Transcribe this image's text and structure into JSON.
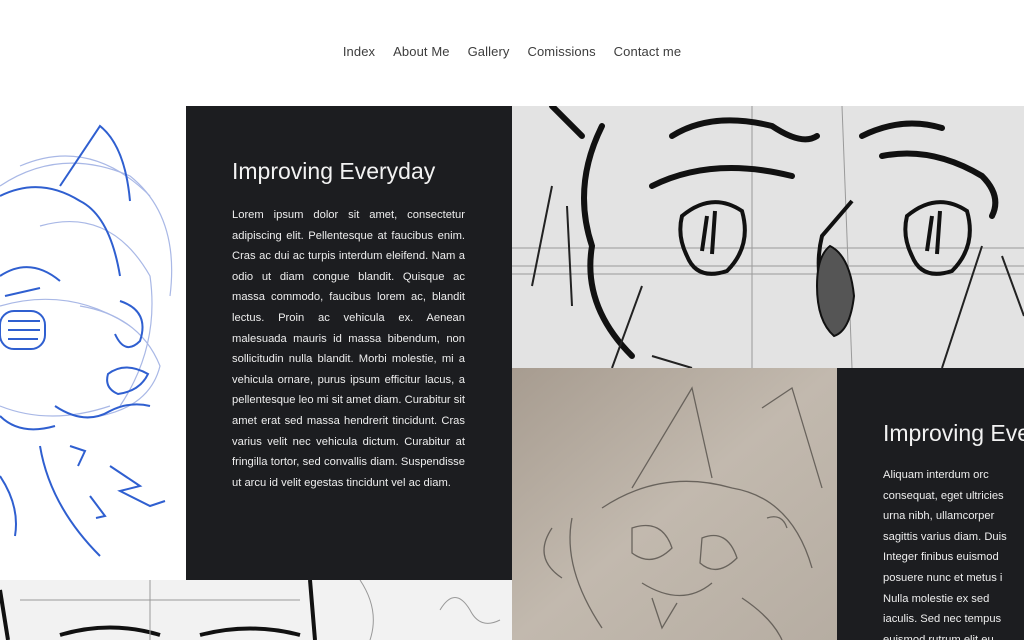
{
  "nav": {
    "items": [
      "Index",
      "About Me",
      "Gallery",
      "Comissions",
      "Contact me"
    ]
  },
  "section1": {
    "title": "Improving Everyday",
    "body": "Lorem ipsum dolor sit amet, consectetur adipiscing elit. Pellentesque at faucibus enim. Cras ac dui ac turpis interdum eleifend. Nam a odio ut diam congue blandit. Quisque ac massa commodo, faucibus lorem ac, blandit lectus. Proin ac vehicula ex. Aenean malesuada mauris id massa bibendum, non sollicitudin nulla blandit. Morbi molestie, mi a vehicula ornare, purus ipsum efficitur lacus, a pellentesque leo mi sit amet diam. Curabitur sit amet erat sed massa hendrerit tincidunt. Cras varius velit nec vehicula dictum. Curabitur at fringilla tortor, sed convallis diam. Suspendisse ut arcu id velit egestas tincidunt vel ac diam."
  },
  "section2": {
    "title": "Improving Eve",
    "lines": [
      "Aliquam interdum orc",
      "consequat, eget ultricies",
      "urna nibh, ullamcorper",
      "sagittis varius diam. Duis",
      "Integer finibus euismod",
      "posuere nunc et metus i",
      "Nulla molestie ex sed",
      "iaculis. Sed nec tempus",
      "euismod rutrum elit eu"
    ]
  },
  "colors": {
    "dark_panel": "#1c1d20",
    "blue_sketch": "#2f5fd0",
    "nav_text": "#3d3d3d"
  }
}
